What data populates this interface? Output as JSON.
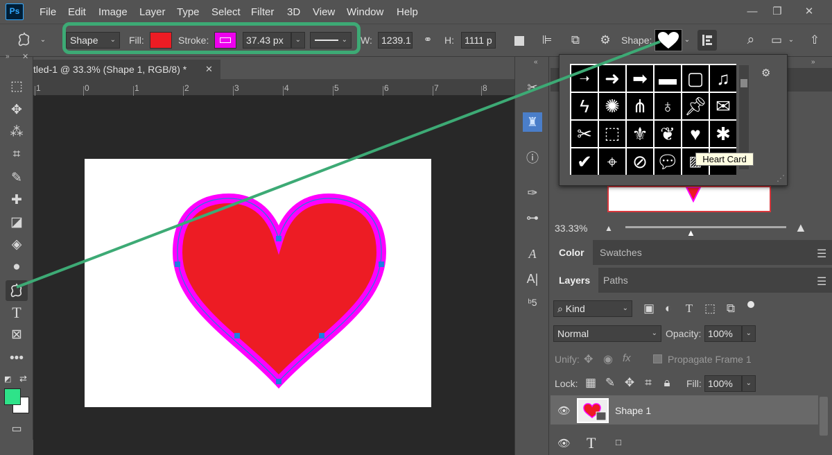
{
  "app": {
    "logo": "Ps"
  },
  "menu": [
    "File",
    "Edit",
    "Image",
    "Layer",
    "Type",
    "Select",
    "Filter",
    "3D",
    "View",
    "Window",
    "Help"
  ],
  "window_controls": {
    "minimize": "—",
    "restore": "❐",
    "close": "✕"
  },
  "options": {
    "mode": "Shape",
    "fill_label": "Fill:",
    "fill_color": "#ed1c24",
    "stroke_label": "Stroke:",
    "stroke_color": "#ee00ee",
    "stroke_width": "37.43 px",
    "w_label": "W:",
    "w_value": "1239.1:",
    "h_label": "H:",
    "h_value": "1111 p",
    "shape_label": "Shape:"
  },
  "document": {
    "tab_title": "tled-1 @ 33.3% (Shape 1, RGB/8) *",
    "close": "✕",
    "ruler_labels": [
      "1",
      "0",
      "1",
      "2",
      "3",
      "4",
      "5",
      "6",
      "7",
      "8"
    ]
  },
  "shape_picker": {
    "tooltip": "Heart Card",
    "gear": "⚙"
  },
  "navigator": {
    "zoom": "33.33%"
  },
  "panels": {
    "color_tab": "Color",
    "swatches_tab": "Swatches",
    "layers_tab": "Layers",
    "paths_tab": "Paths",
    "kind": "Kind",
    "blend_mode": "Normal",
    "opacity_label": "Opacity:",
    "opacity_value": "100%",
    "unify_label": "Unify:",
    "propagate_label": "Propagate Frame 1",
    "lock_label": "Lock:",
    "fill_label": "Fill:",
    "fill_value": "100%"
  },
  "layers": [
    {
      "name": "Shape 1"
    }
  ],
  "colors": {
    "foreground": "#2ee389",
    "background": "#ffffff",
    "highlight": "#3daa75",
    "heart_fill": "#ed1c24",
    "heart_stroke": "#ff00ff",
    "anchor": "#1e7fe0"
  }
}
